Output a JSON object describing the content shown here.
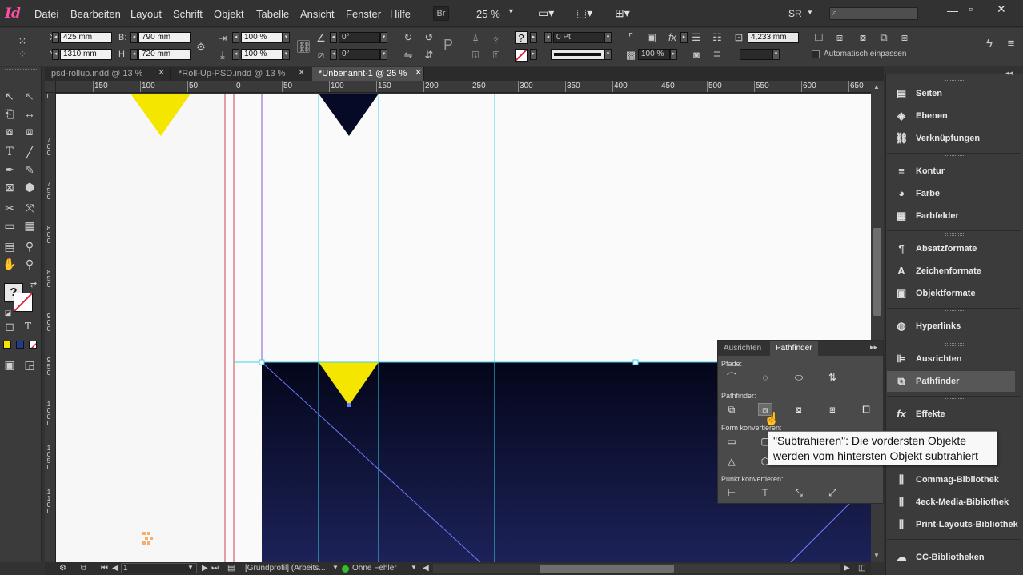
{
  "app": {
    "logo": "Id"
  },
  "menubar": {
    "items": [
      "Datei",
      "Bearbeiten",
      "Layout",
      "Schrift",
      "Objekt",
      "Tabelle",
      "Ansicht",
      "Fenster",
      "Hilfe"
    ],
    "bridge_label": "Br",
    "zoom": "25 %",
    "workspace": "SR",
    "search_placeholder": ""
  },
  "controlbar": {
    "x_label": "X:",
    "x_value": "425 mm",
    "y_label": "Y:",
    "y_value": "1310 mm",
    "w_label": "B:",
    "w_value": "790 mm",
    "h_label": "H:",
    "h_value": "720 mm",
    "scale_x": "100 %",
    "scale_y": "100 %",
    "rotate": "0°",
    "shear": "0°",
    "stroke_weight": "0 Pt",
    "width_value": "4,233 mm",
    "opacity": "100 %",
    "autofit_label": "Automatisch einpassen"
  },
  "tabs": [
    {
      "label": "psd-rollup.indd @ 13 %",
      "active": false
    },
    {
      "label": "*Roll-Up-PSD.indd @ 13 %",
      "active": false
    },
    {
      "label": "*Unbenannt-1 @ 25 %",
      "active": true
    }
  ],
  "ruler": {
    "h_labels": [
      "150",
      "100",
      "50",
      "0",
      "50",
      "100",
      "150",
      "200",
      "250",
      "300",
      "350",
      "400",
      "450",
      "500",
      "550",
      "600",
      "650"
    ],
    "v_labels": [
      "0",
      "7\n0\n0",
      "7\n5\n0",
      "8\n0\n0",
      "8\n5\n0",
      "9\n0\n0",
      "9\n5\n0",
      "1\n0\n0\n0",
      "1\n0\n5\n0",
      "1\n1\n0\n0"
    ]
  },
  "dock": {
    "items": [
      {
        "label": "Seiten",
        "icon": "pages-icon",
        "glyph": "▤"
      },
      {
        "label": "Ebenen",
        "icon": "layers-icon",
        "glyph": "◈"
      },
      {
        "label": "Verknüpfungen",
        "icon": "links-icon",
        "glyph": "⛓"
      },
      {
        "label": "Kontur",
        "icon": "stroke-icon",
        "glyph": "≡"
      },
      {
        "label": "Farbe",
        "icon": "color-icon",
        "glyph": "◕"
      },
      {
        "label": "Farbfelder",
        "icon": "swatches-icon",
        "glyph": "▦"
      },
      {
        "label": "Absatzformate",
        "icon": "paragraph-styles-icon",
        "glyph": "¶"
      },
      {
        "label": "Zeichenformate",
        "icon": "character-styles-icon",
        "glyph": "A"
      },
      {
        "label": "Objektformate",
        "icon": "object-styles-icon",
        "glyph": "▣"
      },
      {
        "label": "Hyperlinks",
        "icon": "hyperlinks-icon",
        "glyph": "◍"
      },
      {
        "label": "Ausrichten",
        "icon": "align-icon",
        "glyph": "⊫"
      },
      {
        "label": "Pathfinder",
        "icon": "pathfinder-icon",
        "glyph": "⧉"
      },
      {
        "label": "Effekte",
        "icon": "effects-icon",
        "glyph": "fx"
      },
      {
        "label": "Commag-Bibliothek",
        "icon": "library-icon",
        "glyph": "⫼"
      },
      {
        "label": "4eck-Media-Bibliothek",
        "icon": "library-icon",
        "glyph": "⫼"
      },
      {
        "label": "Print-Layouts-Bibliothek",
        "icon": "library-icon",
        "glyph": "⫼"
      },
      {
        "label": "CC-Bibliotheken",
        "icon": "cc-libraries-icon",
        "glyph": "☁"
      }
    ]
  },
  "pathfinder": {
    "tab_align": "Ausrichten",
    "tab_pathfinder": "Pathfinder",
    "section_paths": "Pfade:",
    "section_pathfinder": "Pathfinder:",
    "section_convert_shape": "Form konvertieren:",
    "section_convert_point": "Punkt konvertieren:"
  },
  "tooltip": {
    "line1": "\"Subtrahieren\": Die vordersten Objekte",
    "line2": "werden vom hintersten Objekt subtrahiert"
  },
  "statusbar": {
    "page": "1",
    "profile": "[Grundprofil] (Arbeits...",
    "errors": "Ohne Fehler"
  },
  "colors": {
    "yellow": "#f5e600",
    "navy": "#060a26",
    "guide": "#3fd0e8",
    "selection": "#6a7cff",
    "margin_red": "#d0405a"
  }
}
